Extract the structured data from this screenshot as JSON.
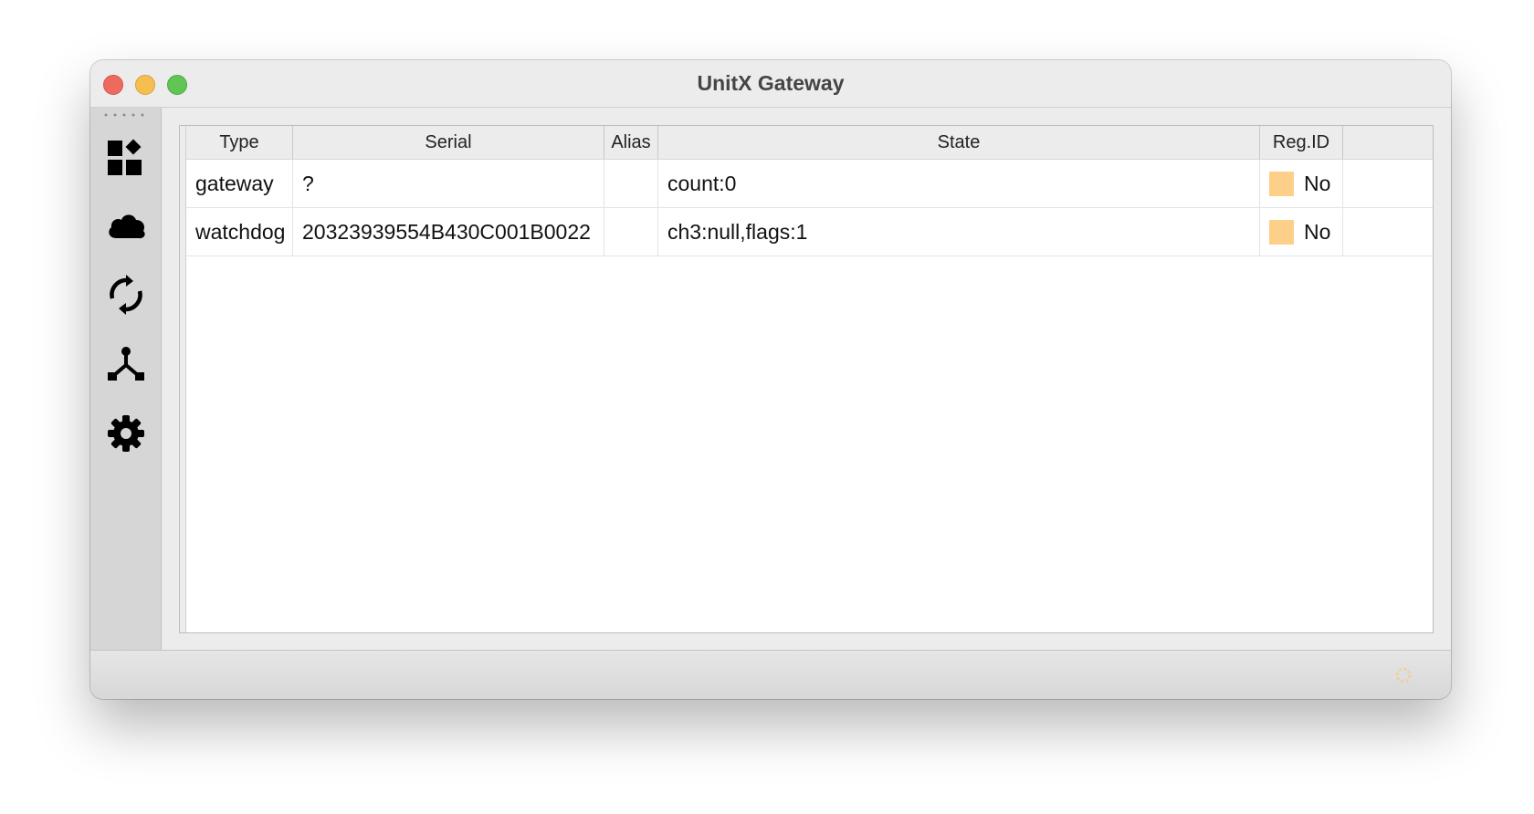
{
  "window": {
    "title": "UnitX Gateway"
  },
  "sidebar": {
    "items": [
      {
        "icon": "dashboard-icon"
      },
      {
        "icon": "cloud-icon"
      },
      {
        "icon": "sync-icon"
      },
      {
        "icon": "network-icon"
      },
      {
        "icon": "gear-icon"
      }
    ]
  },
  "table": {
    "columns": [
      "Type",
      "Serial",
      "Alias",
      "State",
      "Reg.ID"
    ],
    "rows": [
      {
        "type": "gateway",
        "serial": "?",
        "alias": "",
        "state": "count:0",
        "reg_id": "No",
        "reg_color": "#fdd08a"
      },
      {
        "type": "watchdog",
        "serial": "20323939554B430C001B0022",
        "alias": "",
        "state": "ch3:null,flags:1",
        "reg_id": "No",
        "reg_color": "#fdd08a"
      }
    ]
  },
  "status": {
    "indicator_color": "#f4c86a"
  }
}
